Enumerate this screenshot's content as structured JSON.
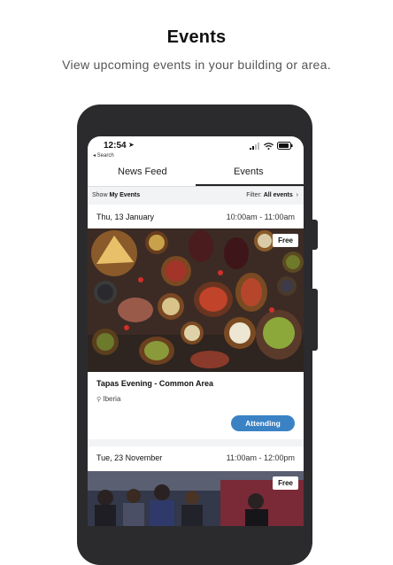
{
  "hero": {
    "title": "Events",
    "subtitle": "View upcoming events in your building or area."
  },
  "status_bar": {
    "time": "12:54",
    "back_label": "◂ Search"
  },
  "tabs": [
    {
      "label": "News Feed",
      "active": false
    },
    {
      "label": "Events",
      "active": true
    }
  ],
  "filter_bar": {
    "show_prefix": "Show",
    "show_value": "My Events",
    "filter_prefix": "Filter:",
    "filter_value": "All events"
  },
  "events": [
    {
      "date": "Thu, 13 January",
      "time": "10:00am - 11:00am",
      "badge": "Free",
      "title": "Tapas Evening - Common Area",
      "location": "Iberia",
      "action_label": "Attending"
    },
    {
      "date": "Tue, 23 November",
      "time": "11:00am - 12:00pm",
      "badge": "Free"
    }
  ],
  "colors": {
    "accent": "#3b82c4",
    "phone_frame": "#2b2b2d",
    "filter_bg": "#f2f3f5"
  }
}
